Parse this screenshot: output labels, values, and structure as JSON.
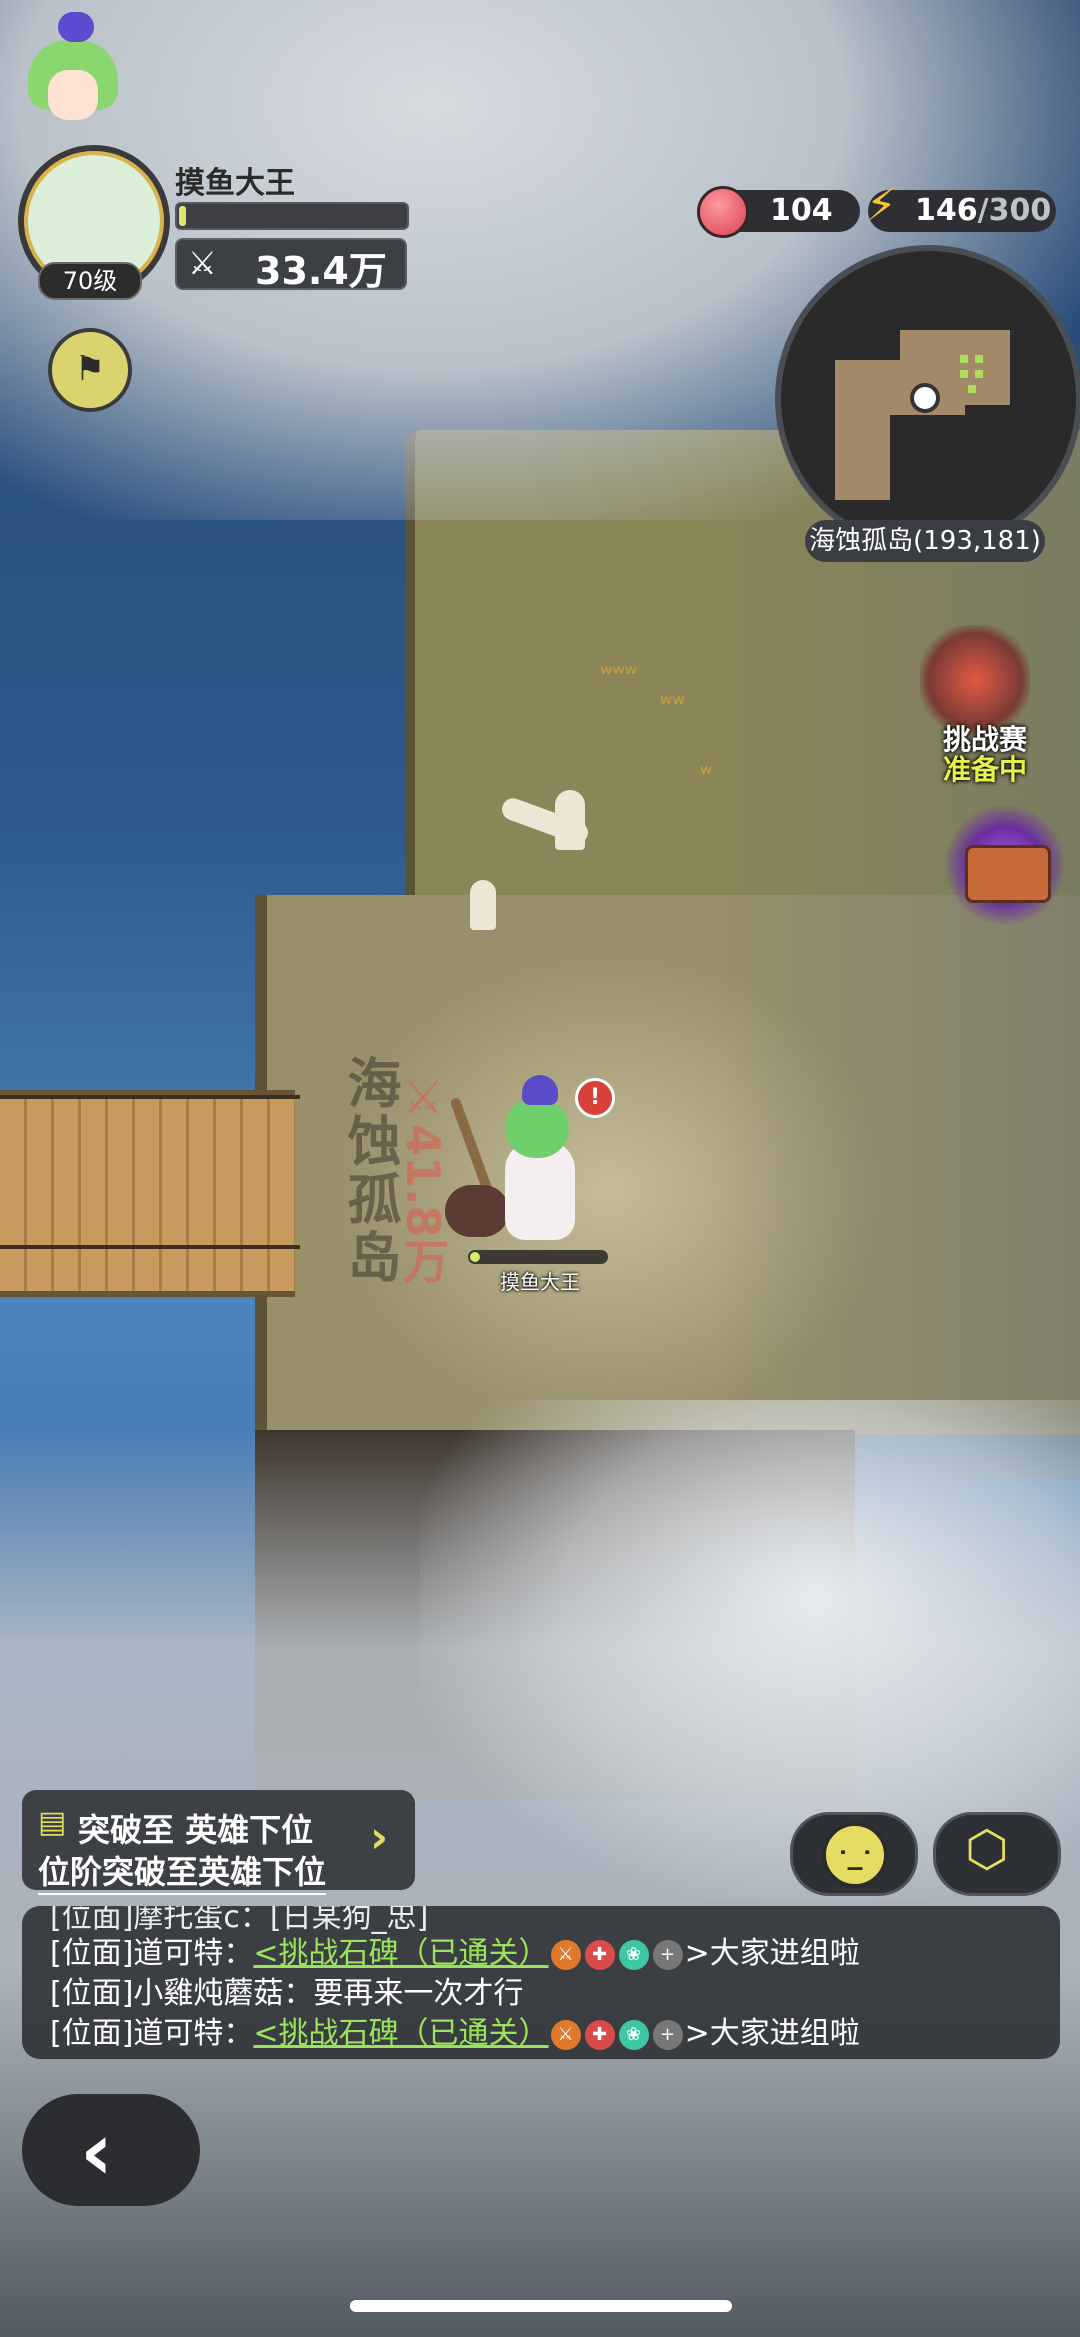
{
  "player": {
    "name": "摸鱼大王",
    "level": "70级",
    "power": "33.4万",
    "power_icon": "crossed-swords-icon",
    "xp_fraction": 0.03
  },
  "resources": {
    "apples": "104",
    "energy_current": "146",
    "energy_max": "/300"
  },
  "minimap": {
    "location": "海蚀孤岛(193,181)"
  },
  "events": {
    "challenge_title": "挑战赛",
    "challenge_status": "准备中"
  },
  "world": {
    "area_name": "海蚀孤岛",
    "area_power": "41.8万",
    "hero_name": "摸鱼大王",
    "alert_mark": "!"
  },
  "quest": {
    "title": "突破至 英雄下位",
    "description": "位阶突破至英雄下位"
  },
  "chat": {
    "partial_line": "[位面]摩托蛋c：[日某狗_忠]",
    "lines": [
      {
        "prefix": "[位面]道可特：",
        "link": "<挑战石碑（已通关）",
        "suffix": ">大家进组啦"
      },
      {
        "prefix": "[位面]小雞炖蘑菇：",
        "text": "要再来一次才行"
      },
      {
        "prefix": "[位面]道可特：",
        "link": "<挑战石碑（已通关）",
        "suffix": ">大家进组啦"
      }
    ]
  },
  "colors": {
    "accent_yellow": "#e5dd62",
    "link_green": "#9be35a",
    "hud_dark": "#2d2f33"
  }
}
